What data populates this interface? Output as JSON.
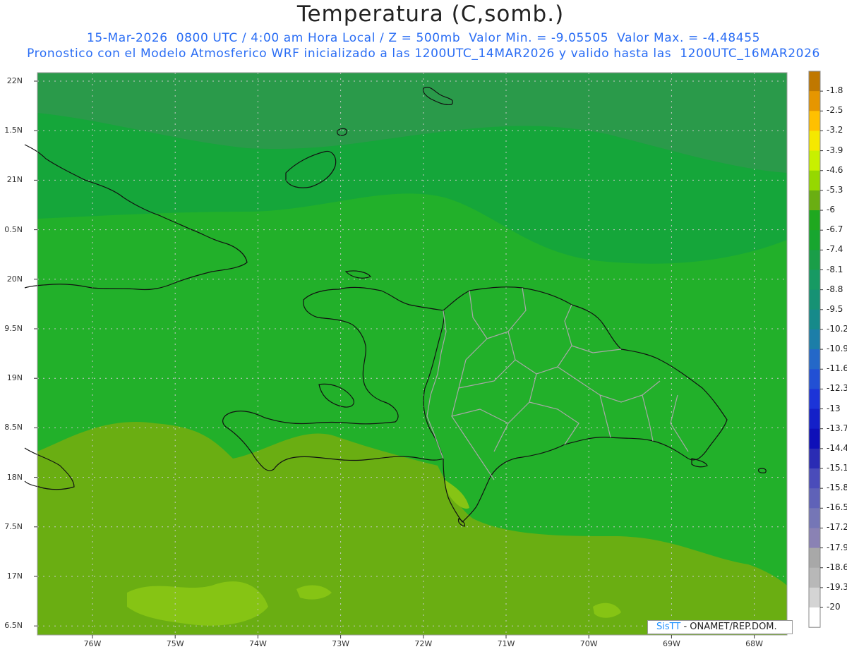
{
  "header": {
    "title": "Temperatura (C,somb.)",
    "subtitle_line1": "15-Mar-2026  0800 UTC / 4:00 am Hora Local / Z = 500mb  Valor Min. = -9.05505  Valor Max. = -4.48455",
    "subtitle_line2": "Pronostico con el Modelo Atmosferico WRF inicializado a las 1200UTC_14MAR2026 y valido hasta las  1200UTC_16MAR2026"
  },
  "map": {
    "lat_labels": [
      "22N",
      "1.5N",
      "21N",
      "0.5N",
      "20N",
      "9.5N",
      "19N",
      "8.5N",
      "18N",
      "7.5N",
      "17N",
      "6.5N"
    ],
    "lon_labels": [
      "76W",
      "75W",
      "74W",
      "73W",
      "72W",
      "71W",
      "70W",
      "69W",
      "68W"
    ],
    "fill_colors": {
      "dark_green": "#2a9a4a",
      "mid_green": "#15a63a",
      "green": "#22b02a",
      "yellow_green": "#6aae12",
      "light_green": "#86c414",
      "coast_line": "#111111",
      "province_line": "#a8a8a8"
    }
  },
  "colorbar": {
    "levels": [
      "-1.8",
      "-2.5",
      "-3.2",
      "-3.9",
      "-4.6",
      "-5.3",
      "-6",
      "-6.7",
      "-7.4",
      "-8.1",
      "-8.8",
      "-9.5",
      "-10.2",
      "-10.9",
      "-11.6",
      "-12.3",
      "-13",
      "-13.7",
      "-14.4",
      "-15.1",
      "-15.8",
      "-16.5",
      "-17.2",
      "-17.9",
      "-18.6",
      "-19.3",
      "-20"
    ],
    "colors": [
      "#c07800",
      "#e69600",
      "#ffc000",
      "#f5e800",
      "#c8f000",
      "#96d800",
      "#6aae12",
      "#1fa81f",
      "#17a62f",
      "#1a9e48",
      "#179a63",
      "#169274",
      "#168a8a",
      "#1c7ea8",
      "#2468c8",
      "#2250d4",
      "#1c34d8",
      "#1420c8",
      "#0e10b8",
      "#2a2cb4",
      "#4a4cba",
      "#5f62b8",
      "#7576b6",
      "#8a82b4",
      "#a8a8a8",
      "#b8b8b8",
      "#d4d4d4",
      "#ffffff"
    ]
  },
  "credit": {
    "brand": "SisTT",
    "text": "- ONAMET/REP.DOM."
  }
}
